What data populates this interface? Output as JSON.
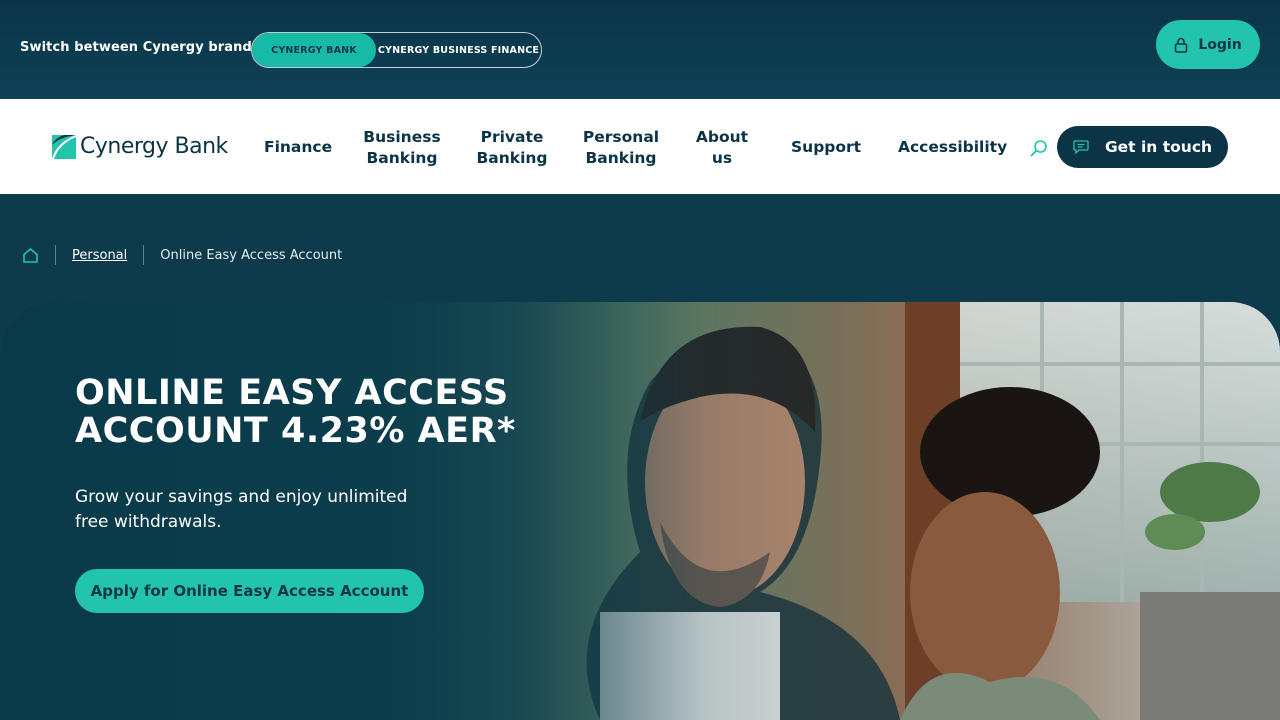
{
  "topbar": {
    "switch_label": "Switch between Cynergy brands:",
    "brands": [
      "CYNERGY BANK",
      "CYNERGY BUSINESS FINANCE"
    ],
    "active_brand": "CYNERGY BANK",
    "login_label": "Login"
  },
  "navbar": {
    "logo_text": "Cynergy Bank",
    "items": [
      {
        "label": "Finance"
      },
      {
        "label": "Business Banking"
      },
      {
        "label": "Private Banking"
      },
      {
        "label": "Personal Banking"
      },
      {
        "label": "About us"
      },
      {
        "label": "Support"
      },
      {
        "label": "Accessibility"
      }
    ],
    "cta_label": "Get in touch"
  },
  "breadcrumb": {
    "link": "Personal",
    "current": "Online Easy Access Account"
  },
  "hero": {
    "title": "ONLINE EASY ACCESS ACCOUNT 4.23% AER*",
    "subtitle": "Grow your savings and enjoy unlimited free withdrawals.",
    "cta_label": "Apply for Online Easy Access Account"
  },
  "colors": {
    "navy": "#0b3447",
    "teal": "#22c4ae",
    "white": "#ffffff"
  },
  "icons": [
    "lock-icon",
    "logo-mark",
    "search-icon",
    "chat-icon",
    "home-icon"
  ]
}
